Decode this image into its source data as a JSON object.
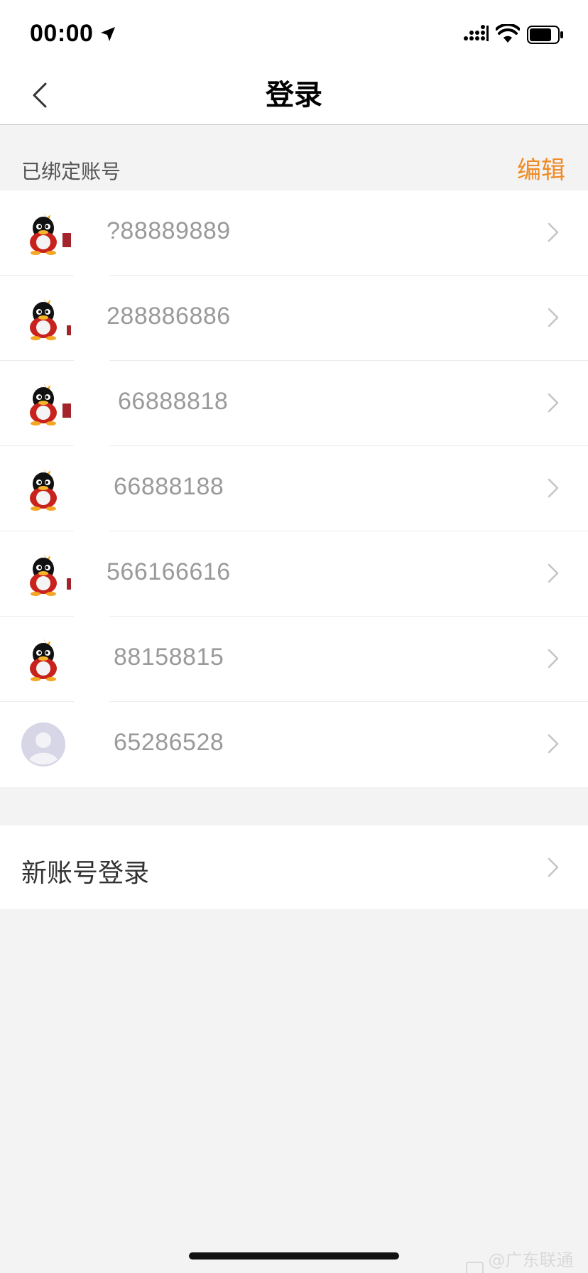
{
  "status_bar": {
    "time": "00:00"
  },
  "nav": {
    "title": "登录"
  },
  "section": {
    "label": "已绑定账号",
    "edit_label": "编辑"
  },
  "accounts": [
    {
      "number": "?88889889",
      "avatar": "qq-penguin-icon"
    },
    {
      "number": "288886886",
      "avatar": "qq-penguin-icon"
    },
    {
      "number": "66888818",
      "avatar": "qq-penguin-icon"
    },
    {
      "number": "66888188",
      "avatar": "qq-penguin-icon"
    },
    {
      "number": "566166616",
      "avatar": "qq-penguin-icon"
    },
    {
      "number": "88158815",
      "avatar": "qq-penguin-icon"
    },
    {
      "number": "65286528",
      "avatar": "default-avatar-icon"
    }
  ],
  "new_account": {
    "label": "新账号登录"
  },
  "watermark": "@广东联通吧",
  "colors": {
    "accent": "#f08a24",
    "background": "#f3f3f3",
    "number_text": "#9a9a9a"
  }
}
